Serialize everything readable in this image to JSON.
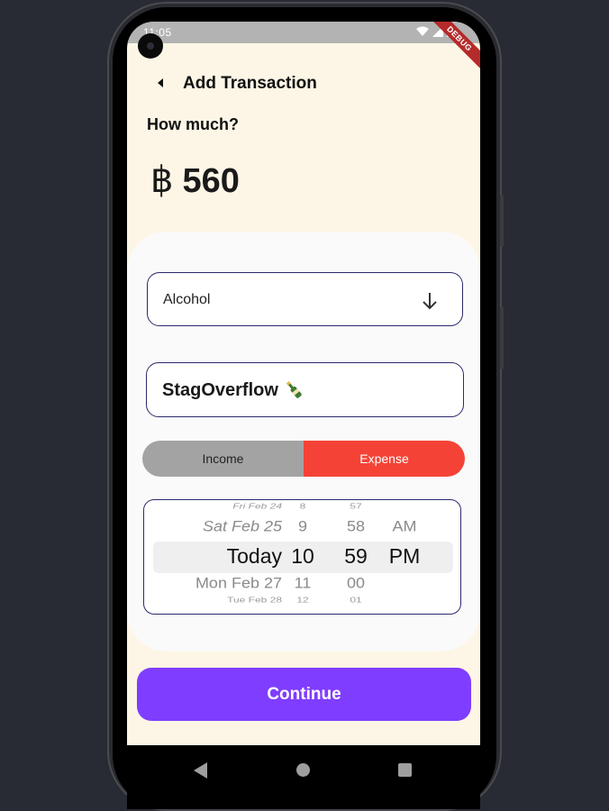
{
  "status_bar": {
    "time": "11:05",
    "debug_label": "DEBUG"
  },
  "header": {
    "title": "Add Transaction"
  },
  "amount_section": {
    "prompt": "How much?",
    "currency_symbol": "฿",
    "amount": "560"
  },
  "category": {
    "selected": "Alcohol"
  },
  "description": {
    "value": "StagOverflow"
  },
  "type_toggle": {
    "income_label": "Income",
    "expense_label": "Expense",
    "selected": "Expense",
    "expense_color": "#f44336",
    "income_color": "#a3a3a3"
  },
  "date_picker": {
    "rows": [
      {
        "date": "Fri Feb 24",
        "hour": "8",
        "minute": "57",
        "ampm": ""
      },
      {
        "date": "Sat Feb 25",
        "hour": "9",
        "minute": "58",
        "ampm": "AM"
      },
      {
        "date": "Today",
        "hour": "10",
        "minute": "59",
        "ampm": "PM"
      },
      {
        "date": "Mon Feb 27",
        "hour": "11",
        "minute": "00",
        "ampm": ""
      },
      {
        "date": "Tue Feb 28",
        "hour": "12",
        "minute": "01",
        "ampm": ""
      }
    ]
  },
  "actions": {
    "continue_label": "Continue",
    "accent_color": "#7f3dff"
  },
  "icons": {
    "back": "back-arrow-icon",
    "dropdown": "arrow-down-icon",
    "emoji": "champagne-bottle-icon",
    "wifi": "wifi-icon",
    "signal": "signal-icon",
    "battery": "battery-icon",
    "camera": "camera-icon"
  }
}
